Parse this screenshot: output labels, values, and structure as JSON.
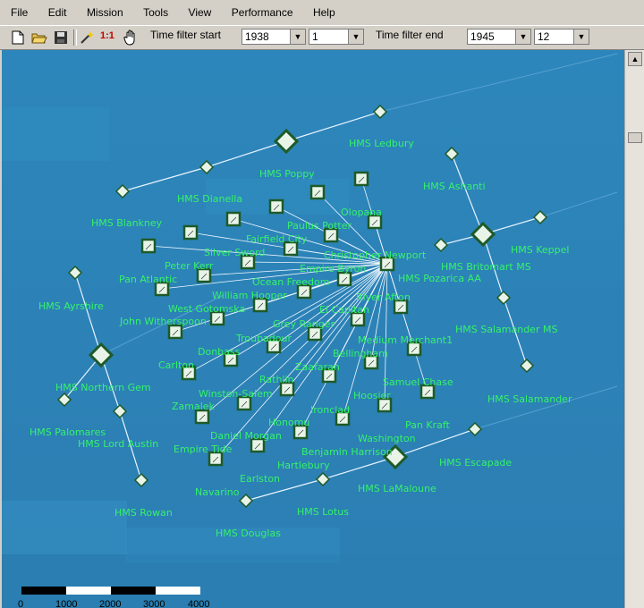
{
  "menu": [
    "File",
    "Edit",
    "Mission",
    "Tools",
    "View",
    "Performance",
    "Help"
  ],
  "toolbar": {
    "new_icon": "new-document-icon",
    "open_icon": "open-folder-icon",
    "save_icon": "save-disk-icon",
    "wand_icon": "magic-wand-icon",
    "ratio_label": "1:1",
    "hand_icon": "hand-pan-icon",
    "filter_start_label": "Time filter start",
    "filter_start_year": "1938",
    "filter_start_month": "1",
    "filter_end_label": "Time filter end",
    "filter_end_year": "1945",
    "filter_end_month": "12"
  },
  "scale": [
    "0",
    "1000",
    "2000",
    "3000",
    "4000"
  ],
  "labels": [
    "HMS Ledbury",
    "HMS Poppy",
    "HMS Ashanti",
    "HMS Dianella",
    "Olopana",
    "HMS Blankney",
    "Paulus Potter",
    "Fairfield City",
    "HMS Keppel",
    "Silver Sword",
    "Christopher Newport",
    "Peter Kerr",
    "Empire Byron",
    "HMS Britomart MS",
    "HMS Pozarica AA",
    "Pan Atlantic",
    "Ocean Freedom",
    "HMS Ayrshire",
    "William Hooper",
    "River Afton",
    "West Gotomska",
    "El Capitan",
    "John Witherspoon",
    "Grey Ranger",
    "HMS Salamander MS",
    "Troubadour",
    "Medium Merchant1",
    "Donbass",
    "Bellingham",
    "Carlton",
    "Zaafaran",
    "HMS Northern Gem",
    "Samuel Chase",
    "Winston-Salem",
    "Rathlin",
    "Hoosier",
    "HMS Salamander",
    "Zamalek",
    "Ironclad",
    "HMS Palomares",
    "Daniel Morgan",
    "Honomu",
    "Pan Kraft",
    "HMS Lord Austin",
    "Washington",
    "Empire Tide",
    "Benjamin Harrison",
    "HMS Escapade",
    "Hartlebury",
    "Earlston",
    "HMS LaMaloune",
    "Navarino",
    "HMS Lotus",
    "HMS Rowan",
    "HMS Douglas"
  ]
}
